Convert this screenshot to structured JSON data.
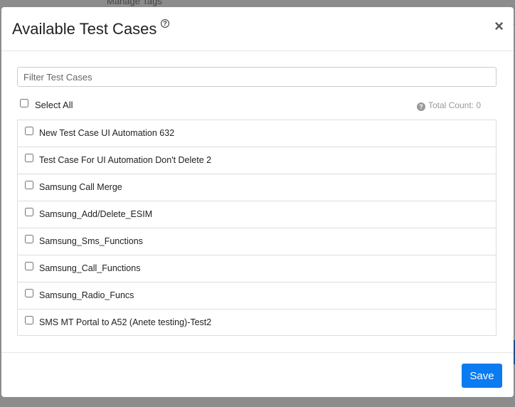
{
  "background": {
    "partial_text": "Manage Tags"
  },
  "modal": {
    "title": "Available Test Cases",
    "help_icon": "question-circle-icon",
    "close_glyph": "×"
  },
  "filter": {
    "placeholder": "Filter Test Cases",
    "value": ""
  },
  "select_all": {
    "label": "Select All",
    "checked": false
  },
  "total_count": {
    "icon": "question-circle-icon",
    "text": "Total Count: 0"
  },
  "test_cases": [
    {
      "label": "New Test Case UI Automation 632",
      "checked": false
    },
    {
      "label": "Test Case For UI Automation Don't Delete 2",
      "checked": false
    },
    {
      "label": "Samsung Call Merge",
      "checked": false
    },
    {
      "label": "Samsung_Add/Delete_ESIM",
      "checked": false
    },
    {
      "label": "Samsung_Sms_Functions",
      "checked": false
    },
    {
      "label": "Samsung_Call_Functions",
      "checked": false
    },
    {
      "label": "Samsung_Radio_Funcs",
      "checked": false
    },
    {
      "label": "SMS MT Portal to A52 (Anete testing)-Test2",
      "checked": false
    }
  ],
  "footer": {
    "save_label": "Save"
  },
  "colors": {
    "primary": "#0a7bf0",
    "overlay": "#7f7f7f"
  }
}
